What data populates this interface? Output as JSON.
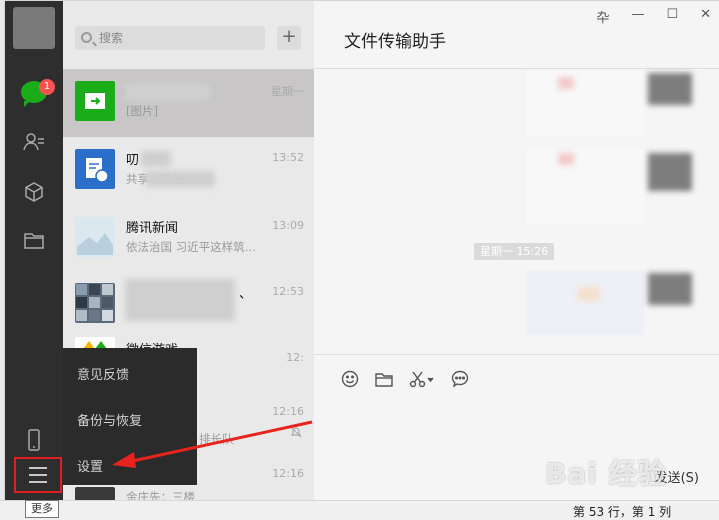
{
  "sidebar": {
    "badge_count": "1",
    "tooltip": "更多"
  },
  "search": {
    "placeholder": "搜索",
    "add_label": "+"
  },
  "chats": [
    {
      "name": "",
      "preview": "[图片]",
      "time": "星期一"
    },
    {
      "name": "叨",
      "preview": "共享…抓住…",
      "time": "13:52"
    },
    {
      "name": "腾讯新闻",
      "preview": "依法治国 习近平这样筑…",
      "time": "13:09"
    },
    {
      "name": "、",
      "preview": "",
      "time": "12:53"
    },
    {
      "name": "微信游戏",
      "preview": "",
      "time": "12:"
    },
    {
      "name": "",
      "preview": "排长队",
      "time": "12:16"
    },
    {
      "name": "",
      "preview": "金庄先：三楼",
      "time": "12:16"
    }
  ],
  "more_menu": {
    "items": [
      "意见反馈",
      "备份与恢复",
      "设置"
    ]
  },
  "chat_window": {
    "title": "文件传输助手",
    "controls": [
      "卆",
      "—",
      "☐",
      "✕"
    ],
    "time_divider": "星期一 15:26",
    "send_label": "发送(S)"
  },
  "statusbar": {
    "position": "第 53 行，第 1 列"
  },
  "watermark": "Bai 经验",
  "colors": {
    "sidebar_bg": "#2e2e2e",
    "wechat_green": "#1aad19",
    "badge_red": "#fa5151",
    "highlight_red": "#e02020"
  }
}
